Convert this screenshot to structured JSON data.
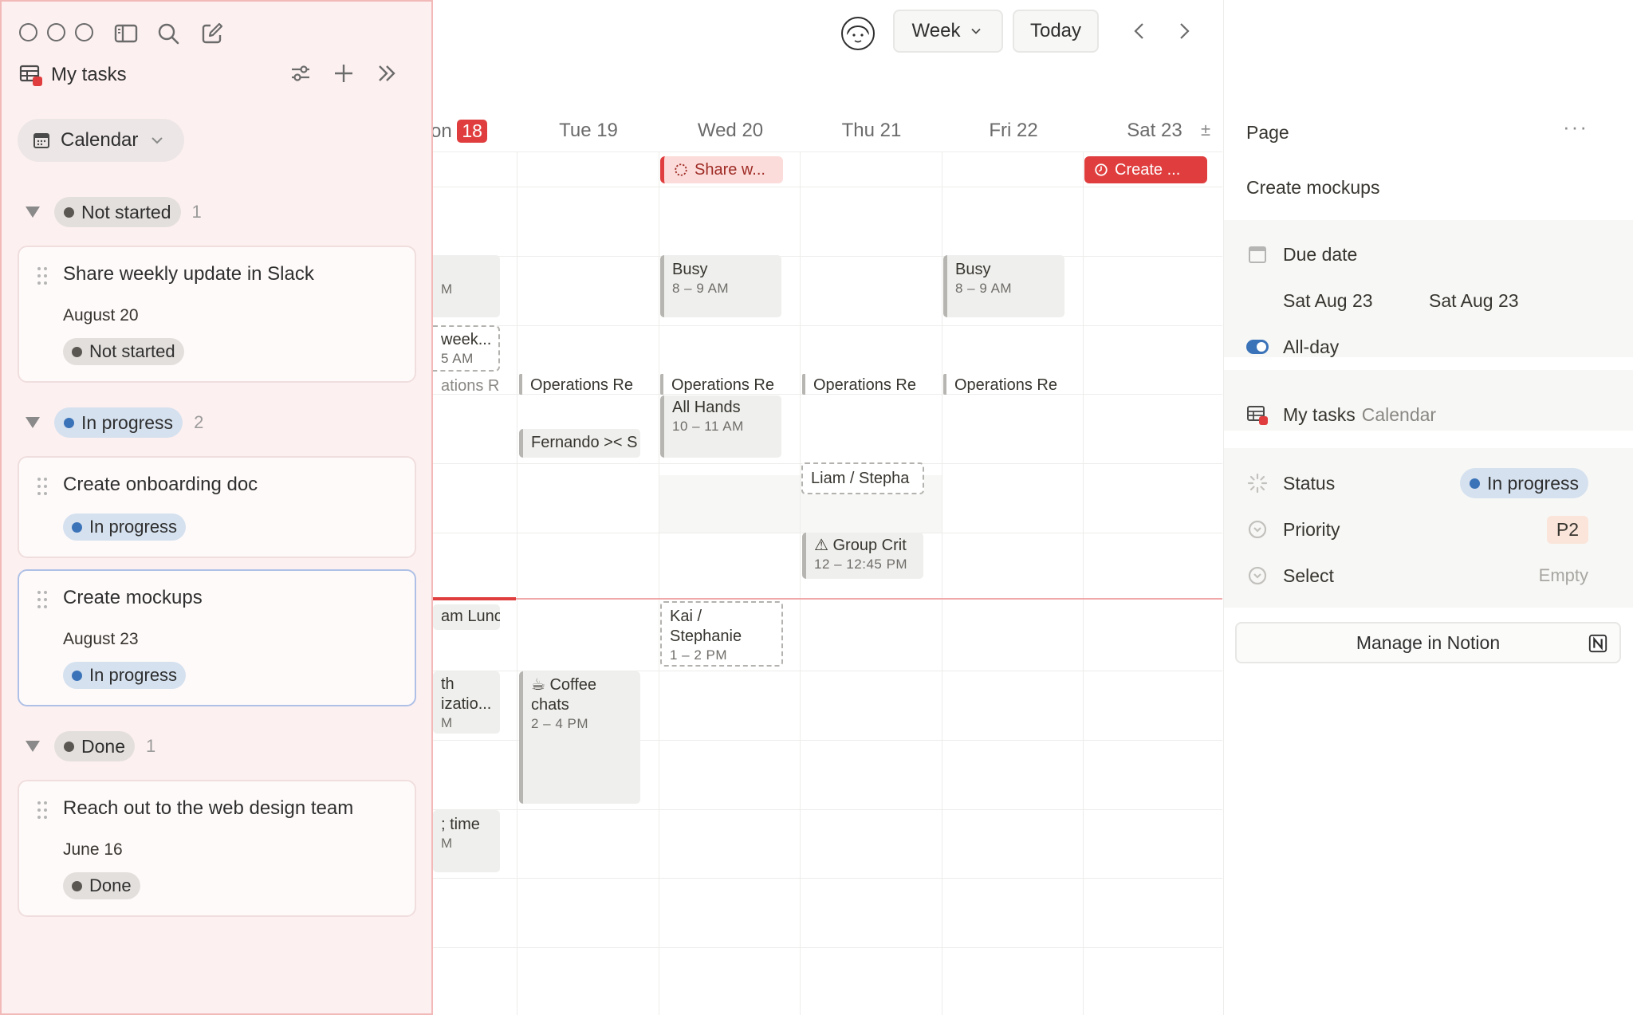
{
  "sidebar": {
    "title": "My tasks",
    "view": "Calendar",
    "groups": [
      {
        "status": "Not started",
        "count": "1",
        "tasks": [
          {
            "title": "Share weekly update in Slack",
            "date": "August 20",
            "status": "Not started"
          }
        ]
      },
      {
        "status": "In progress",
        "count": "2",
        "tasks": [
          {
            "title": "Create onboarding doc",
            "date": "",
            "status": "In progress"
          },
          {
            "title": "Create mockups",
            "date": "August 23",
            "status": "In progress"
          }
        ]
      },
      {
        "status": "Done",
        "count": "1",
        "tasks": [
          {
            "title": "Reach out to the web design team",
            "date": "June 16",
            "status": "Done"
          }
        ]
      }
    ]
  },
  "toolbar": {
    "view_label": "Week",
    "today_label": "Today"
  },
  "calendar": {
    "days": [
      {
        "label": "on",
        "badge": "18"
      },
      {
        "label": "Tue 19"
      },
      {
        "label": "Wed 20"
      },
      {
        "label": "Thu 21"
      },
      {
        "label": "Fri 22"
      },
      {
        "label": "Sat 23"
      }
    ],
    "plusminus": "±",
    "allday_events": [
      {
        "title": "Share w..."
      },
      {
        "title": "Create ..."
      }
    ],
    "events": {
      "mon_m": "M",
      "mon_week": "week...",
      "mon_week_time": "5 AM",
      "mon_ops": "ations Re",
      "mon_lunch": "am Lunc",
      "mon_th": "th",
      "mon_izatio": "izatio...",
      "mon_m2": "M",
      "mon_time": "; time",
      "mon_m3": "M",
      "wed_busy": "Busy",
      "wed_busy_time": "8 – 9 AM",
      "fri_busy": "Busy",
      "fri_busy_time": "8 – 9 AM",
      "ops": "Operations Re",
      "all_hands": "All Hands",
      "all_hands_time": "10 – 11 AM",
      "fernando": "Fernando >< S",
      "liam": "Liam / Stepha",
      "group_crit": "Group Crit",
      "group_crit_time": "12 – 12:45 PM",
      "kai": "Kai / Stephanie",
      "kai_time": "1 – 2 PM",
      "coffee": "☕ Coffee chats",
      "coffee_time": "2 – 4 PM"
    }
  },
  "page_panel": {
    "heading": "Page",
    "title": "Create mockups",
    "due_label": "Due date",
    "start_date": "Sat Aug 23",
    "end_date": "Sat Aug 23",
    "allday_label": "All-day",
    "db_name": "My tasks",
    "db_view": "Calendar",
    "status_label": "Status",
    "status_value": "In progress",
    "priority_label": "Priority",
    "priority_value": "P2",
    "select_label": "Select",
    "select_value": "Empty",
    "manage_label": "Manage in Notion"
  },
  "colors": {
    "accent_red": "#e03e3e",
    "status_blue": "#3b73b8",
    "sidebar_bg": "#fdf0f0"
  }
}
